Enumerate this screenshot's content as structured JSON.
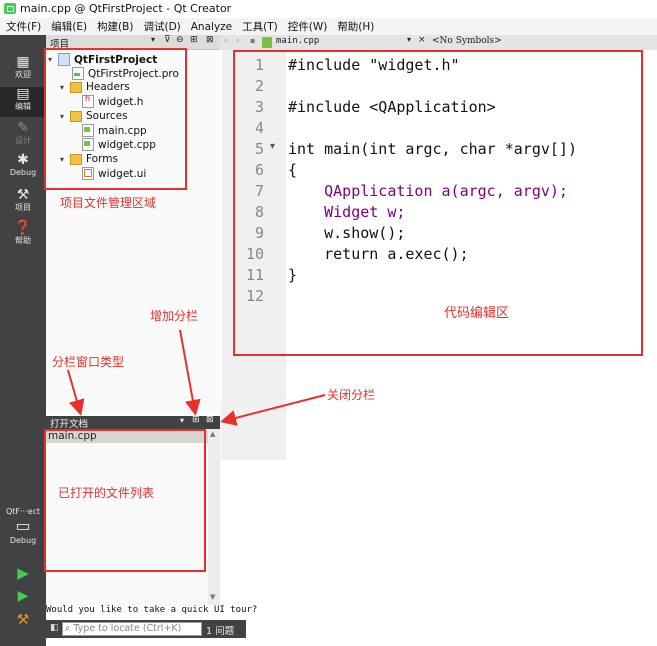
{
  "window": {
    "title": "main.cpp @ QtFirstProject - Qt Creator"
  },
  "menu": [
    "文件(F)",
    "编辑(E)",
    "构建(B)",
    "调试(D)",
    "Analyze",
    "工具(T)",
    "控件(W)",
    "帮助(H)"
  ],
  "modes": {
    "welcome": "欢迎",
    "edit": "编辑",
    "design": "设计",
    "debug": "Debug",
    "project": "项目",
    "help": "帮助",
    "kit_name": "QtF···ect",
    "kit_build": "Debug"
  },
  "project_pane": {
    "title": "项目",
    "tree": [
      {
        "label": "QtFirstProject",
        "icon": "project-icon",
        "level": 0,
        "expanded": true
      },
      {
        "label": "QtFirstProject.pro",
        "icon": "pro-file-icon",
        "level": 1
      },
      {
        "label": "Headers",
        "icon": "folder-icon",
        "level": 1,
        "expanded": true
      },
      {
        "label": "widget.h",
        "icon": "header-file-icon",
        "level": 2
      },
      {
        "label": "Sources",
        "icon": "folder-icon",
        "level": 1,
        "expanded": true
      },
      {
        "label": "main.cpp",
        "icon": "cpp-file-icon",
        "level": 2
      },
      {
        "label": "widget.cpp",
        "icon": "cpp-file-icon",
        "level": 2
      },
      {
        "label": "Forms",
        "icon": "folder-icon",
        "level": 1,
        "expanded": true
      },
      {
        "label": "widget.ui",
        "icon": "ui-file-icon",
        "level": 2
      }
    ]
  },
  "open_docs": {
    "title": "打开文档",
    "files": [
      "main.cpp"
    ]
  },
  "editor": {
    "tab": "main.cpp",
    "symbols": "<No Symbols>",
    "lines": [
      "#include \"widget.h\"",
      "",
      "#include <QApplication>",
      "",
      "int main(int argc, char *argv[])",
      "{",
      "    QApplication a(argc, argv);",
      "    Widget w;",
      "    w.show();",
      "    return a.exec();",
      "}",
      ""
    ],
    "line_numbers": [
      "1",
      "2",
      "3",
      "4",
      "5",
      "6",
      "7",
      "8",
      "9",
      "10",
      "11",
      "12"
    ],
    "fold_marker": "▾"
  },
  "status": {
    "tour": "Would you like to take a quick UI tour?",
    "locator_placeholder": "Type to locate (Ctrl+K)",
    "issues": "1 问题"
  },
  "annotations": {
    "project_area": "项目文件管理区域",
    "code_area": "代码编辑区",
    "add_split": "增加分栏",
    "split_type": "分栏窗口类型",
    "close_split": "关闭分栏",
    "open_files": "已打开的文件列表"
  },
  "colors": {
    "annotation": "#e8302a",
    "sidebar": "#404244",
    "keyword": "#808000",
    "type": "#800080",
    "string": "#008000"
  }
}
